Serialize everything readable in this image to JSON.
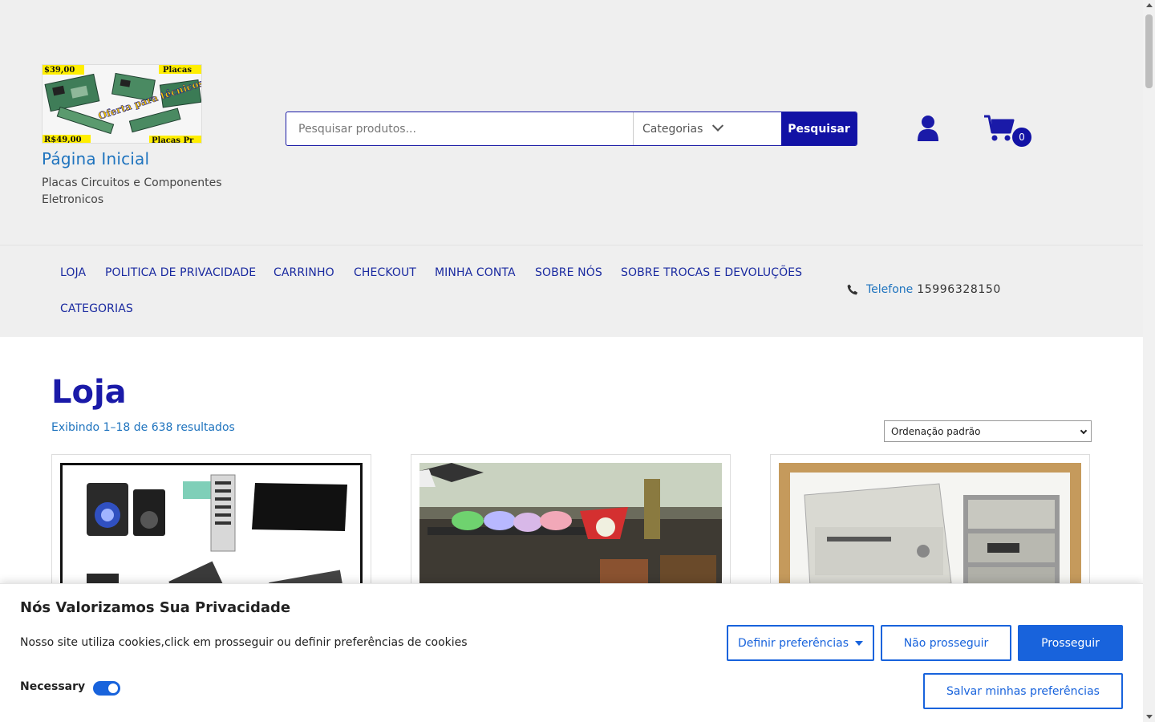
{
  "header": {
    "site_title": "Página Inicial",
    "site_description": "Placas Circuitos e Componentes Eletronicos",
    "logo_texts": [
      "$39,00",
      "Placas",
      "Oferta para técnicos !!!!",
      "R$49,00",
      "Placas Pr"
    ],
    "search": {
      "placeholder": "Pesquisar produtos...",
      "category_label": "Categorias",
      "button_label": "Pesquisar"
    },
    "account_icon": "user-icon",
    "cart_icon": "shopping-cart-icon",
    "cart_count": "0"
  },
  "nav": {
    "items": [
      {
        "label": "LOJA"
      },
      {
        "label": "POLITICA DE PRIVACIDADE"
      },
      {
        "label": "CARRINHO"
      },
      {
        "label": "CHECKOUT"
      },
      {
        "label": "MINHA CONTA"
      },
      {
        "label": "SOBRE NÓS"
      },
      {
        "label": "SOBRE TROCAS E DEVOLUÇÕES"
      },
      {
        "label": "CATEGORIAS"
      }
    ],
    "phone_icon": "phone-icon",
    "phone_label": "Telefone",
    "phone_number": "15996328150"
  },
  "main": {
    "title": "Loja",
    "result_count": "Exibindo 1–18 de 638 resultados",
    "ordering_selected": "Ordenação padrão"
  },
  "cookie": {
    "title": "Nós Valorizamos Sua Privacidade",
    "text": "Nosso site utiliza cookies,click em prosseguir ou definir preferências de cookies",
    "necessary_label": "Necessary",
    "necessary_enabled": true,
    "btn_preferences": "Definir preferências",
    "btn_reject": "Não prosseguir",
    "btn_accept": "Prosseguir",
    "btn_save": "Salvar minhas preferências"
  },
  "colors": {
    "brand_blue": "#1212a5",
    "link_blue": "#1e73be",
    "cookie_blue": "#1863dc",
    "header_bg": "#efefef"
  }
}
